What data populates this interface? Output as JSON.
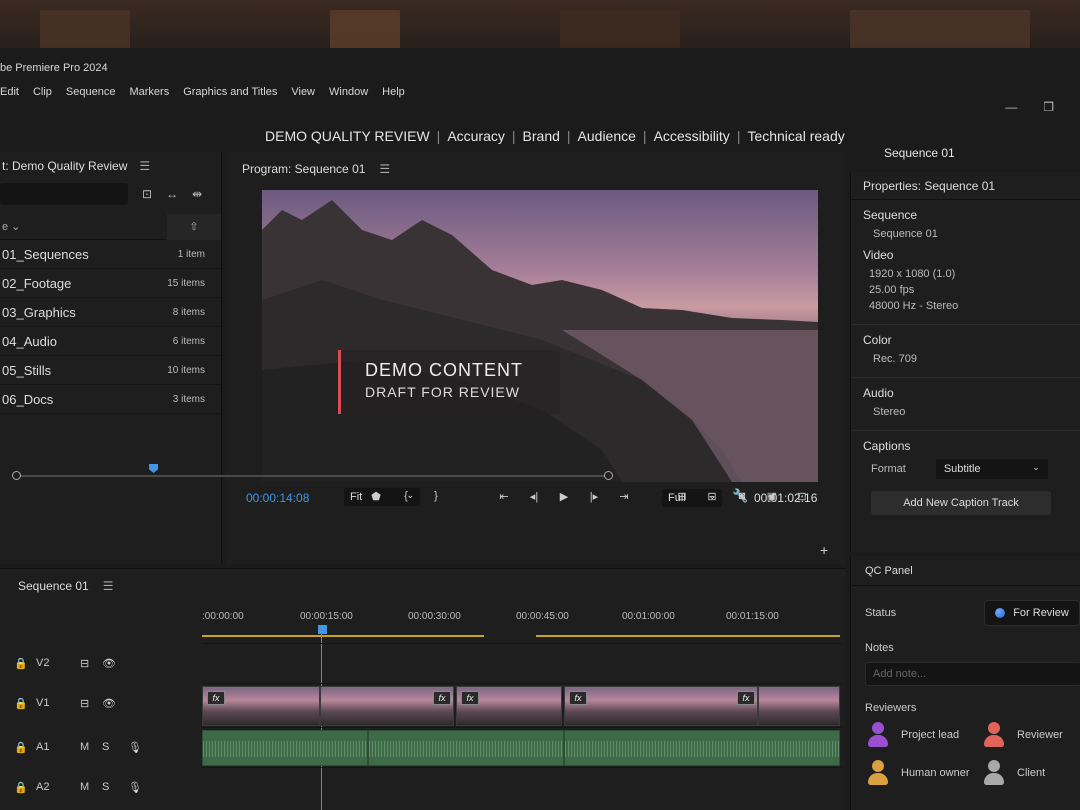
{
  "app": {
    "title": "be Premiere Pro 2024"
  },
  "menu": [
    "Edit",
    "Clip",
    "Sequence",
    "Markers",
    "Graphics and Titles",
    "View",
    "Window",
    "Help"
  ],
  "workspaces": [
    "DEMO QUALITY REVIEW",
    "Accuracy",
    "Brand",
    "Audience",
    "Accessibility",
    "Technical ready"
  ],
  "sequence_label_right": "Sequence 01",
  "project": {
    "title": "t: Demo Quality Review",
    "col_name": "e",
    "bins": [
      {
        "name": "01_Sequences",
        "count": "1 item"
      },
      {
        "name": "02_Footage",
        "count": "15 items"
      },
      {
        "name": "03_Graphics",
        "count": "8 items"
      },
      {
        "name": "04_Audio",
        "count": "6 items"
      },
      {
        "name": "05_Stills",
        "count": "10 items"
      },
      {
        "name": "06_Docs",
        "count": "3 items"
      }
    ]
  },
  "program": {
    "title": "Program: Sequence 01",
    "overlay_line1": "DEMO CONTENT",
    "overlay_line2": "DRAFT FOR REVIEW",
    "timecode_current": "00:00:14:08",
    "fit": "Fit",
    "resolution": "Full",
    "timecode_duration": "00:01:02:16",
    "playhead_fraction": 0.23
  },
  "properties": {
    "title": "Properties: Sequence 01",
    "sequence_label": "Sequence",
    "sequence_name": "Sequence 01",
    "video_label": "Video",
    "video_res": "1920 x 1080 (1.0)",
    "video_fps": "25.00 fps",
    "video_audio": "48000 Hz - Stereo",
    "color_label": "Color",
    "color_value": "Rec. 709",
    "audio_label": "Audio",
    "audio_value": "Stereo",
    "captions_label": "Captions",
    "format_label": "Format",
    "format_value": "Subtitle",
    "add_caption": "Add New Caption Track"
  },
  "qc": {
    "title": "QC Panel",
    "status_label": "Status",
    "status_value": "For Review",
    "notes_label": "Notes",
    "notes_placeholder": "Add note...",
    "reviewers_label": "Reviewers",
    "reviewers": [
      {
        "name": "Project lead",
        "color": "#9a4fd0"
      },
      {
        "name": "Reviewer",
        "color": "#e0645a"
      },
      {
        "name": "Human owner",
        "color": "#d8a040"
      },
      {
        "name": "Client",
        "color": "#a8a8a8"
      }
    ]
  },
  "timeline": {
    "title": "Sequence 01",
    "ticks": [
      ":00:00:00",
      "00:00:15:00",
      "00:00:30:00",
      "00:00:45:00",
      "00:01:00:00",
      "00:01:15:00"
    ],
    "tracks": [
      {
        "name": "V2"
      },
      {
        "name": "V1"
      },
      {
        "name": "A1",
        "m": "M",
        "s": "S"
      },
      {
        "name": "A2",
        "m": "M",
        "s": "S"
      }
    ],
    "fx_label": "fx"
  },
  "colors": {
    "accent": "#3f97e6",
    "overlay_bar": "#d94b55",
    "work_area": "#c9a21e",
    "audio_clip": "#3d6a47"
  }
}
